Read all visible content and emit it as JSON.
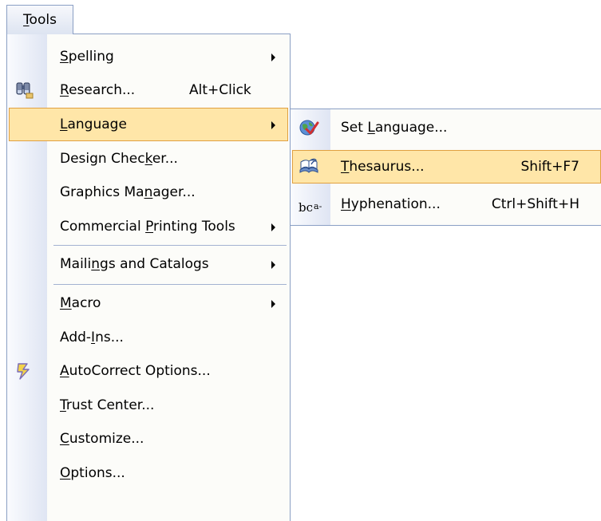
{
  "menubar": {
    "tools": {
      "pre": "",
      "key": "T",
      "post": "ools"
    }
  },
  "tools_menu": {
    "items": [
      {
        "pre": "",
        "key": "S",
        "post": "pelling",
        "shortcut": "",
        "icon": "",
        "submenu": true
      },
      {
        "pre": "",
        "key": "R",
        "post": "esearch...",
        "shortcut": "Alt+Click",
        "icon": "research-binoculars-icon",
        "submenu": false
      },
      {
        "pre": "",
        "key": "L",
        "post": "anguage",
        "shortcut": "",
        "icon": "",
        "submenu": true,
        "highlighted": true
      },
      {
        "pre": "Design Chec",
        "key": "k",
        "post": "er...",
        "shortcut": "",
        "icon": "",
        "submenu": false
      },
      {
        "pre": "Graphics Ma",
        "key": "n",
        "post": "ager...",
        "shortcut": "",
        "icon": "",
        "submenu": false
      },
      {
        "pre": "Commercial ",
        "key": "P",
        "post": "rinting Tools",
        "shortcut": "",
        "icon": "",
        "submenu": true
      },
      {
        "pre": "Maili",
        "key": "n",
        "post": "gs and Catalogs",
        "shortcut": "",
        "icon": "",
        "submenu": true
      },
      {
        "pre": "",
        "key": "M",
        "post": "acro",
        "shortcut": "",
        "icon": "",
        "submenu": true
      },
      {
        "pre": "Add-",
        "key": "I",
        "post": "ns...",
        "shortcut": "",
        "icon": "",
        "submenu": false
      },
      {
        "pre": "",
        "key": "A",
        "post": "utoCorrect Options...",
        "shortcut": "",
        "icon": "autocorrect-lightning-icon",
        "submenu": false
      },
      {
        "pre": "",
        "key": "T",
        "post": "rust Center...",
        "shortcut": "",
        "icon": "",
        "submenu": false
      },
      {
        "pre": "",
        "key": "C",
        "post": "ustomize...",
        "shortcut": "",
        "icon": "",
        "submenu": false
      },
      {
        "pre": "",
        "key": "O",
        "post": "ptions...",
        "shortcut": "",
        "icon": "",
        "submenu": false
      }
    ]
  },
  "language_submenu": {
    "items": [
      {
        "pre": "Set ",
        "key": "L",
        "post": "anguage...",
        "shortcut": "",
        "icon": "set-language-globe-check-icon"
      },
      {
        "pre": "",
        "key": "T",
        "post": "hesaurus...",
        "shortcut": "Shift+F7",
        "icon": "thesaurus-book-icon",
        "highlighted": true
      },
      {
        "pre": "",
        "key": "H",
        "post": "yphenation...",
        "shortcut": "Ctrl+Shift+H",
        "icon": "hyphenation-icon",
        "icon_text": {
          "base": "bc",
          "sup": "a-"
        }
      }
    ]
  },
  "colors": {
    "highlight": "#ffe6a8",
    "highlight_border": "#e0a040",
    "menu_border": "#8a9fc4"
  }
}
